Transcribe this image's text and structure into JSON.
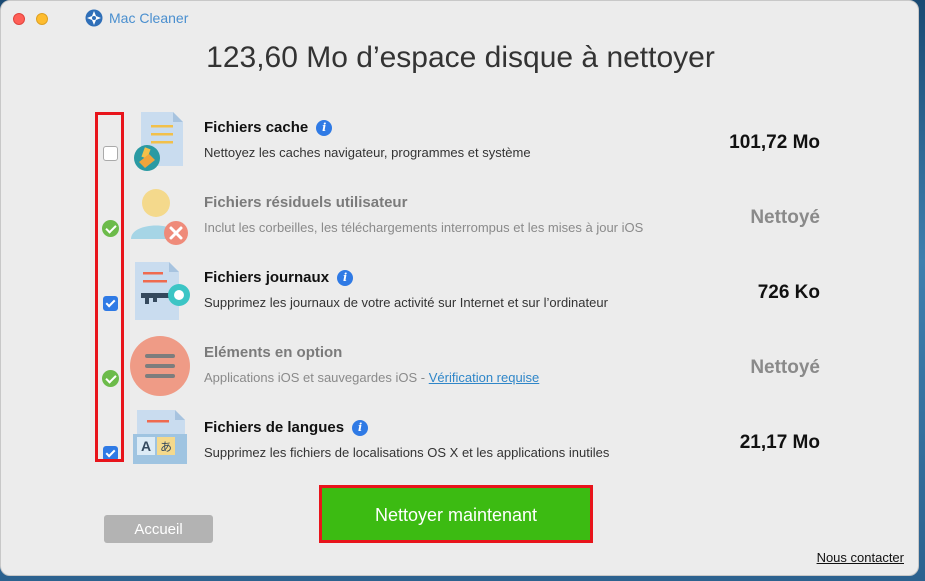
{
  "window": {
    "app_name": "Mac Cleaner"
  },
  "headline": "123,60 Mo d’espace disque à nettoyer",
  "items": [
    {
      "title": "Fichiers cache",
      "info": "i",
      "description": "Nettoyez les caches navigateur, programmes et système",
      "size": "101,72 Mo",
      "state": "unchecked",
      "icon": "cache-files-icon"
    },
    {
      "title": "Fichiers résiduels utilisateur",
      "description": "Inclut les corbeilles, les téléchargements interrompus et les mises à jour iOS",
      "size": "Nettoyé",
      "state": "cleaned",
      "icon": "user-residual-icon"
    },
    {
      "title": "Fichiers journaux",
      "info": "i",
      "description": "Supprimez les journaux de votre activité sur Internet et sur l’ordinateur",
      "size": "726 Ko",
      "state": "checked",
      "icon": "log-files-icon"
    },
    {
      "title": "Eléments en option",
      "description": "Applications iOS et sauvegardes iOS - ",
      "link": "Vérification requise",
      "size": "Nettoyé",
      "state": "cleaned",
      "icon": "optional-items-icon"
    },
    {
      "title": "Fichiers de langues",
      "info": "i",
      "description": "Supprimez les fichiers de localisations OS X et les applications inutiles",
      "size": "21,17 Mo",
      "state": "checked",
      "icon": "language-files-icon"
    }
  ],
  "buttons": {
    "home": "Accueil",
    "clean_now": "Nettoyer maintenant",
    "contact": "Nous contacter"
  },
  "colors": {
    "accent_blue": "#2f7ae5",
    "clean_green": "#3cbb12",
    "done_green": "#6cbb4a",
    "highlight_red": "#e8141b"
  }
}
